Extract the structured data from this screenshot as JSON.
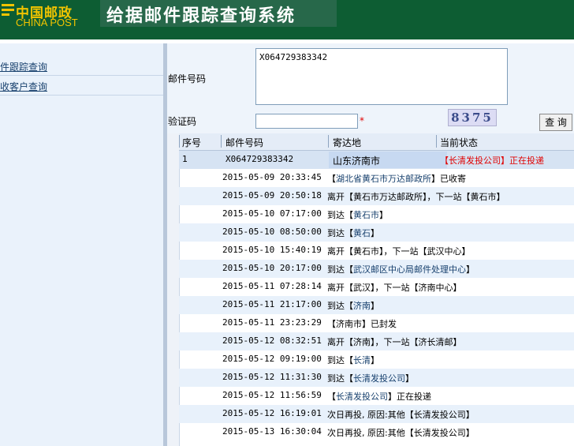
{
  "header": {
    "logo_cn": "中国邮政",
    "logo_en": "CHINA POST",
    "app_title": "给据邮件跟踪查询系统"
  },
  "sidebar": {
    "items": [
      {
        "label": "件跟踪查询"
      },
      {
        "label": "收客户查询"
      }
    ]
  },
  "form": {
    "tracking_label": "邮件号码",
    "tracking_value": "X064729383342",
    "captcha_label": "验证码",
    "captcha_value": "",
    "required_mark": "*",
    "captcha_text": "8375",
    "query_button": "查 询"
  },
  "table": {
    "columns": [
      "序号",
      "邮件号码",
      "寄达地",
      "当前状态"
    ],
    "summary": {
      "index": "1",
      "number": "X064729383342",
      "destination": "山东济南市",
      "status": "【长清发投公司】正在投递"
    },
    "events": [
      {
        "time": "2015-05-09 20:33:45",
        "pre": "【",
        "link": "湖北省黄石市万达邮政所",
        "post": "】已收寄"
      },
      {
        "time": "2015-05-09 20:50:18",
        "pre": "离开【黄石市万达邮政所】，下一站【黄石市】",
        "link": "",
        "post": ""
      },
      {
        "time": "2015-05-10 07:17:00",
        "pre": "到达【",
        "link": "黄石市",
        "post": "】"
      },
      {
        "time": "2015-05-10 08:50:00",
        "pre": "到达【",
        "link": "黄石",
        "post": "】"
      },
      {
        "time": "2015-05-10 15:40:19",
        "pre": "离开【黄石市】，下一站【武汉中心】",
        "link": "",
        "post": ""
      },
      {
        "time": "2015-05-10 20:17:00",
        "pre": "到达【",
        "link": "武汉邮区中心局邮件处理中心",
        "post": "】"
      },
      {
        "time": "2015-05-11 07:28:14",
        "pre": "离开【武汉】，下一站【济南中心】",
        "link": "",
        "post": ""
      },
      {
        "time": "2015-05-11 21:17:00",
        "pre": "到达【",
        "link": "济南",
        "post": "】"
      },
      {
        "time": "2015-05-11 23:23:29",
        "pre": "【济南市】已封发",
        "link": "",
        "post": ""
      },
      {
        "time": "2015-05-12 08:32:51",
        "pre": "离开【济南】，下一站【济长清邮】",
        "link": "",
        "post": ""
      },
      {
        "time": "2015-05-12 09:19:00",
        "pre": "到达【",
        "link": "长清",
        "post": "】"
      },
      {
        "time": "2015-05-12 11:31:30",
        "pre": "到达【",
        "link": "长清发投公司",
        "post": "】"
      },
      {
        "time": "2015-05-12 11:56:59",
        "pre": "【",
        "link": "长清发投公司",
        "post": "】正在投递"
      },
      {
        "time": "2015-05-12 16:19:01",
        "pre": "次日再投, 原因:其他【长清发投公司】",
        "link": "",
        "post": ""
      },
      {
        "time": "2015-05-13 16:30:04",
        "pre": "次日再投, 原因:其他【长清发投公司】",
        "link": "",
        "post": ""
      }
    ]
  },
  "colors": {
    "header_bg": "#0d5d33",
    "logo_gold": "#f2c400",
    "link": "#17406d",
    "status_red": "#e00000"
  }
}
